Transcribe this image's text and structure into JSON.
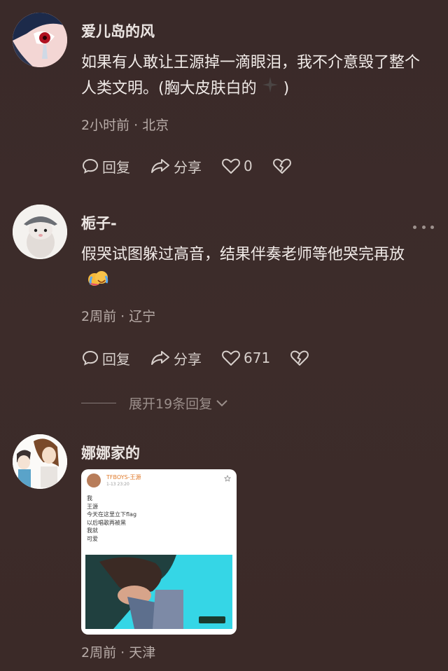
{
  "comments": [
    {
      "author": "爱儿岛的风",
      "text": "如果有人敢让王源掉一滴眼泪，我不介意毁了整个人类文明。(胸大皮肤白的",
      "text_suffix": ")",
      "time": "2小时前",
      "location": "北京",
      "reply_label": "回复",
      "share_label": "分享",
      "likes": "0"
    },
    {
      "author": "栀子-",
      "text": "假哭试图躲过高音，结果伴奏老师等他哭完再放",
      "time": "2周前",
      "location": "辽宁",
      "reply_label": "回复",
      "share_label": "分享",
      "likes": "671",
      "expand_label": "展开19条回复"
    },
    {
      "author": "娜娜家的",
      "time": "2周前",
      "location": "天津",
      "image": {
        "header_name": "TFBOYS-王源",
        "header_date": "1-13 23:20",
        "lines": [
          "我",
          "王源",
          "今天在这里立下flag",
          "以后唱歌再被黑",
          "我就",
          "可爱"
        ]
      }
    }
  ],
  "colors": {
    "background": "#3b2a28",
    "text": "#f1ebe8",
    "meta": "#b8aca8"
  }
}
